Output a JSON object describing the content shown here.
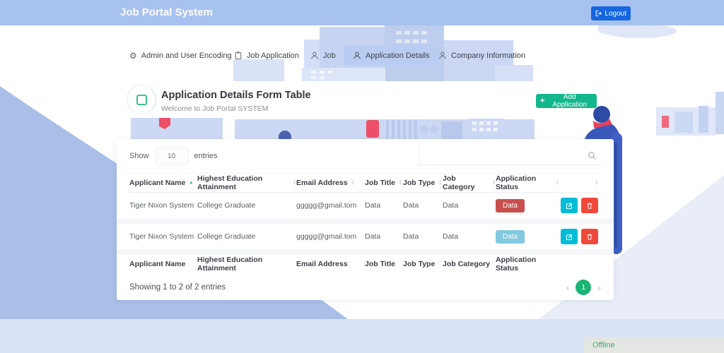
{
  "header": {
    "title": "Job Portal System",
    "logout": {
      "label": "Logout"
    }
  },
  "tabs": [
    {
      "label": "Admin and User Encoding",
      "icon": "gear-icon",
      "active": false
    },
    {
      "label": "Job Application",
      "icon": "clipboard-icon",
      "active": false
    },
    {
      "label": "Job",
      "icon": "person-icon",
      "active": false
    },
    {
      "label": "Application Details",
      "icon": "person-icon",
      "active": true
    },
    {
      "label": "Company Information",
      "icon": "person-icon",
      "active": false
    }
  ],
  "page_header": {
    "title": "Application Details Form Table",
    "subtitle": "Welcome to Job Portal SYSTEM",
    "add_button_plus": "+",
    "add_button_label": "Add Application"
  },
  "table": {
    "length_control": {
      "show_label": "Show",
      "value": "10",
      "entries_label": "entries"
    },
    "search": {
      "placeholder": ""
    },
    "columns": [
      "Applicant Name",
      "Highest Education Attainment",
      "Email Address",
      "Job Title",
      "Job Type",
      "Job Category",
      "Application Status"
    ],
    "rows": [
      {
        "applicant_name": "Tiger Nixon System",
        "education": "College Graduate",
        "email": "ggggg@gmail.tom",
        "job_title": "Data",
        "job_type": "Data",
        "job_category": "Data",
        "status": "Data",
        "status_color": "#c94f4e"
      },
      {
        "applicant_name": "Tiger Nixon System",
        "education": "College Graduate",
        "email": "ggggg@gmail.tom",
        "job_title": "Data",
        "job_type": "Data",
        "job_category": "Data",
        "status": "Data",
        "status_color": "#82c8e0"
      }
    ],
    "summary": "Showing 1 to 2 of 2 entries",
    "pagination": {
      "prev": "‹",
      "current": "1",
      "next": "›"
    }
  },
  "status_bar": {
    "label": "Offline"
  },
  "colors": {
    "header_bg": "#a8c2ef",
    "logout_bg": "#1667e0",
    "active_tab_bg": "#b9ccf2",
    "add_button_bg": "#14b78b",
    "edit_button_bg": "#00bcd6",
    "delete_button_bg": "#f0493c",
    "badge_red": "#c94f4e",
    "badge_blue": "#82c8e0",
    "pagination_active_bg": "#1cb474",
    "sort_active": "#1cb474",
    "offline_text": "#43ad68",
    "offline_bg": "#e4e6e2"
  }
}
